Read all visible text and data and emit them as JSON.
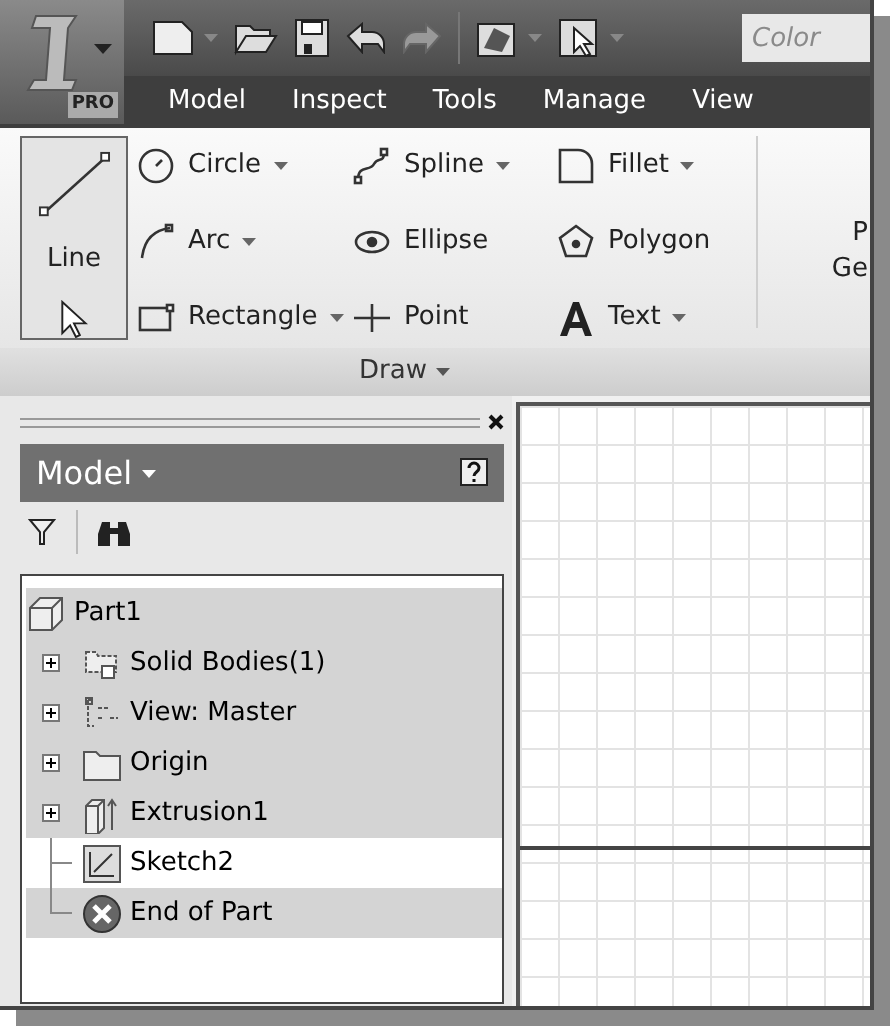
{
  "app_button": {
    "badge": "PRO"
  },
  "quick_access": {
    "color_field": {
      "placeholder": "Color"
    }
  },
  "ribbon_tabs": [
    {
      "label": "Model",
      "selected": false
    },
    {
      "label": "Inspect",
      "selected": false
    },
    {
      "label": "Tools",
      "selected": false
    },
    {
      "label": "Manage",
      "selected": false
    },
    {
      "label": "View",
      "selected": false
    }
  ],
  "draw_panel": {
    "big_tool": {
      "label": "Line",
      "highlighted": true
    },
    "columns": [
      [
        {
          "kind": "circle",
          "label": "Circle",
          "dropdown": true
        },
        {
          "kind": "arc",
          "label": "Arc",
          "dropdown": true
        },
        {
          "kind": "rectangle",
          "label": "Rectangle",
          "dropdown": true
        }
      ],
      [
        {
          "kind": "spline",
          "label": "Spline",
          "dropdown": true
        },
        {
          "kind": "ellipse",
          "label": "Ellipse",
          "dropdown": false
        },
        {
          "kind": "point",
          "label": "Point",
          "dropdown": false
        }
      ],
      [
        {
          "kind": "fillet",
          "label": "Fillet",
          "dropdown": true
        },
        {
          "kind": "polygon",
          "label": "Polygon",
          "dropdown": false
        },
        {
          "kind": "text",
          "label": "Text",
          "dropdown": true
        }
      ]
    ],
    "cut_off_labels": [
      "P",
      "Ge"
    ],
    "title": "Draw"
  },
  "browser": {
    "title": "Model",
    "tree": [
      {
        "label": "Part1",
        "kind": "part",
        "expandable": false,
        "selected": false,
        "children": [
          {
            "label": "Solid Bodies(1)",
            "kind": "bodies",
            "expandable": true,
            "selected": false
          },
          {
            "label": "View: Master",
            "kind": "view",
            "expandable": true,
            "selected": false
          },
          {
            "label": "Origin",
            "kind": "folder",
            "expandable": true,
            "selected": false
          },
          {
            "label": "Extrusion1",
            "kind": "extrusion",
            "expandable": true,
            "selected": false
          },
          {
            "label": "Sketch2",
            "kind": "sketch",
            "expandable": false,
            "selected": true
          },
          {
            "label": "End of Part",
            "kind": "end",
            "expandable": false,
            "selected": false
          }
        ]
      }
    ]
  }
}
